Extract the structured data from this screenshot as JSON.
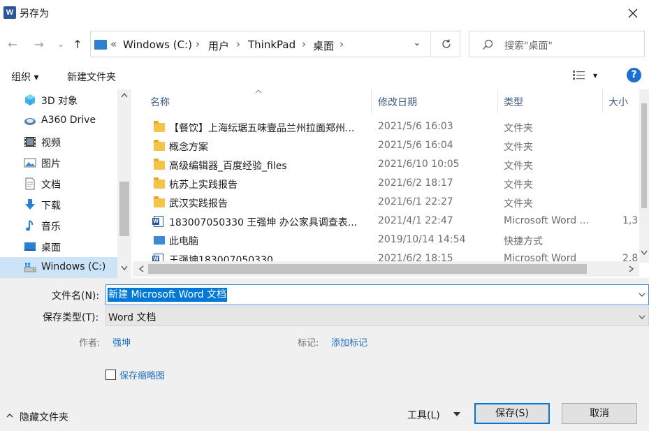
{
  "window": {
    "title": "另存为",
    "app_icon": "word-icon"
  },
  "nav": {
    "back": "←",
    "forward": "→",
    "recent": "⌄",
    "up": "↑",
    "address_prefix": "«",
    "breadcrumb": [
      "Windows (C:)",
      "用户",
      "ThinkPad",
      "桌面"
    ],
    "separator": "›",
    "dropdown": "⌄",
    "search_placeholder": "搜索\"桌面\""
  },
  "toolbar": {
    "organize": "组织 ▾",
    "new_folder": "新建文件夹",
    "view_toggle": "▾",
    "help": "?"
  },
  "sidebar": {
    "items": [
      {
        "label": "3D 对象",
        "icon": "3d-objects-icon"
      },
      {
        "label": "A360 Drive",
        "icon": "a360-drive-icon"
      },
      {
        "label": "视频",
        "icon": "videos-icon"
      },
      {
        "label": "图片",
        "icon": "pictures-icon"
      },
      {
        "label": "文档",
        "icon": "documents-icon"
      },
      {
        "label": "下载",
        "icon": "downloads-icon"
      },
      {
        "label": "音乐",
        "icon": "music-icon"
      },
      {
        "label": "桌面",
        "icon": "desktop-icon"
      },
      {
        "label": "Windows (C:)",
        "icon": "drive-icon",
        "selected": true
      }
    ]
  },
  "file_list": {
    "columns": {
      "name": "名称",
      "date": "修改日期",
      "type": "类型",
      "size": "大小"
    },
    "rows": [
      {
        "name": "【餐饮】上海纭琚五味壹品兰州拉面郑州...",
        "date": "2021/5/6 16:03",
        "type": "文件夹",
        "size": "",
        "icon": "folder-icon"
      },
      {
        "name": "概念方案",
        "date": "2021/5/6 16:04",
        "type": "文件夹",
        "size": "",
        "icon": "folder-icon"
      },
      {
        "name": "高级编辑器_百度经验_files",
        "date": "2021/6/10 10:05",
        "type": "文件夹",
        "size": "",
        "icon": "folder-icon"
      },
      {
        "name": "杭苏上实践报告",
        "date": "2021/6/2 18:17",
        "type": "文件夹",
        "size": "",
        "icon": "folder-icon"
      },
      {
        "name": "武汉实践报告",
        "date": "2021/6/1 22:27",
        "type": "文件夹",
        "size": "",
        "icon": "folder-icon"
      },
      {
        "name": "183007050330 王强坤 办公家具调查表...",
        "date": "2021/4/1 22:47",
        "type": "Microsoft Word ...",
        "size": "1,3",
        "icon": "word-doc-icon"
      },
      {
        "name": "此电脑",
        "date": "2019/10/14 14:54",
        "type": "快捷方式",
        "size": "",
        "icon": "shortcut-icon"
      },
      {
        "name": "王强坤183007050330",
        "date": "2021/6/2 18:15",
        "type": "Microsoft Word",
        "size": "2,8",
        "icon": "word-doc-icon"
      }
    ]
  },
  "form": {
    "filename_label": "文件名(N):",
    "filename_value": "新建 Microsoft Word 文档",
    "filetype_label": "保存类型(T):",
    "filetype_value": "Word 文档",
    "author_label": "作者:",
    "author_value": "强坤",
    "tags_label": "标记:",
    "tags_value": "添加标记",
    "thumbnail_label": "保存缩略图"
  },
  "footer": {
    "hide_folders": "隐藏文件夹",
    "tools": "工具(L)",
    "save": "保存(S)",
    "cancel": "取消"
  },
  "colors": {
    "accent": "#0078d7",
    "link": "#1f6fbf",
    "header_text": "#3d5a80",
    "selection": "#cce4f7"
  }
}
